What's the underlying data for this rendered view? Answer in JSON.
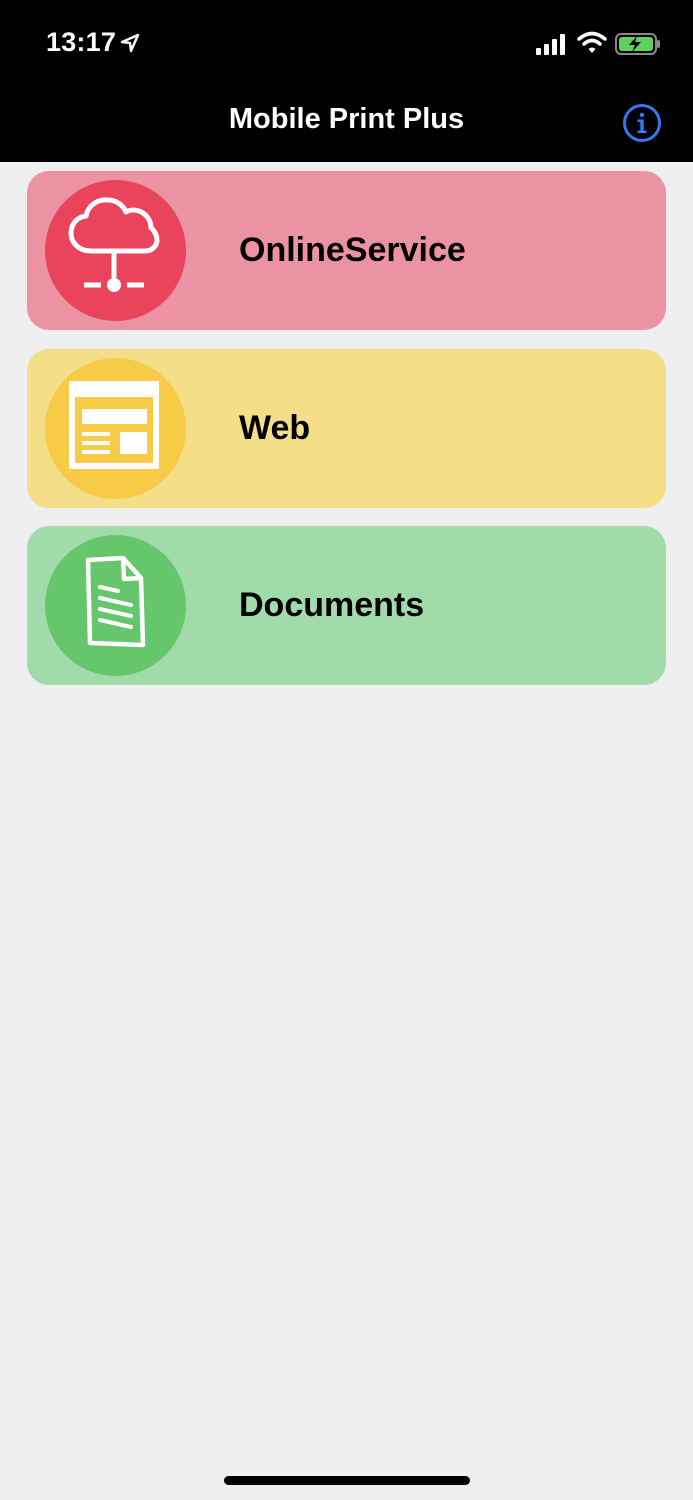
{
  "status_bar": {
    "time": "13:17",
    "location_icon": "location-arrow-icon",
    "signal_icon": "cellular-signal-icon",
    "wifi_icon": "wifi-icon",
    "battery_icon": "battery-charging-icon"
  },
  "nav": {
    "title": "Mobile Print Plus",
    "info_icon": "info-icon",
    "info_color": "#3478f6"
  },
  "menu": {
    "items": [
      {
        "label": "OnlineService",
        "icon": "cloud-network-icon",
        "card_color": "#ec93a3",
        "circle_color": "#ea435c"
      },
      {
        "label": "Web",
        "icon": "web-page-icon",
        "card_color": "#f4de87",
        "circle_color": "#f7cb45"
      },
      {
        "label": "Documents",
        "icon": "document-icon",
        "card_color": "#a1dbaa",
        "circle_color": "#66c66b"
      }
    ]
  }
}
